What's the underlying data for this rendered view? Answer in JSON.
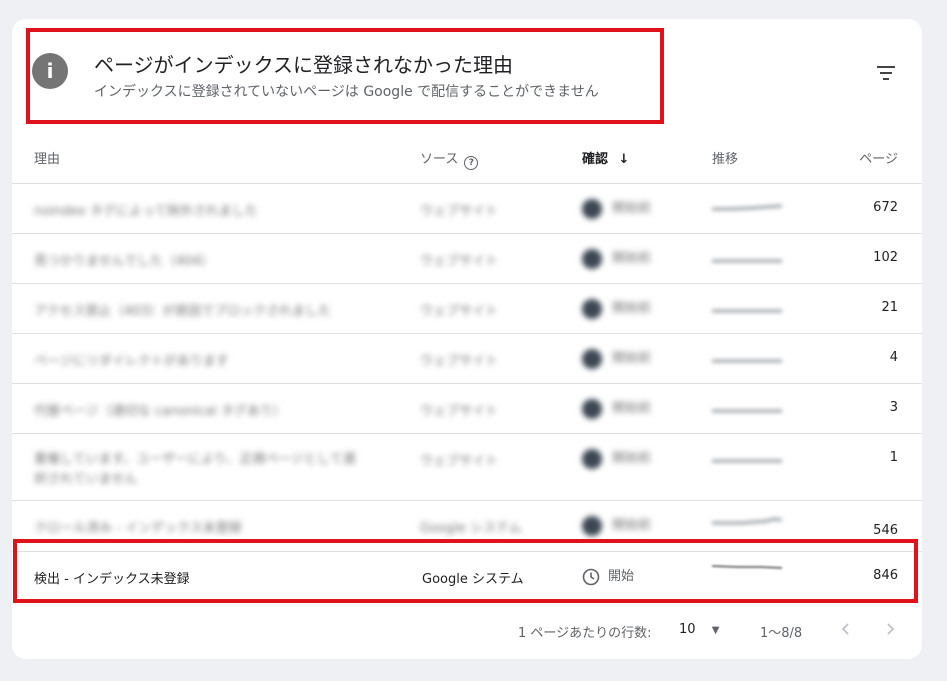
{
  "header": {
    "title": "ページがインデックスに登録されなかった理由",
    "subtitle": "インデックスに登録されていないページは Google で配信することができません",
    "info_icon": "info-icon",
    "filter_icon": "filter-icon"
  },
  "columns": {
    "reason": "理由",
    "source": "ソース",
    "validation": "確認",
    "trend": "推移",
    "pages": "ページ"
  },
  "rows": [
    {
      "reason": "noindex タグによって除外されました",
      "source": "ウェブサイト",
      "status": "開始前",
      "pages": "672"
    },
    {
      "reason": "見つかりませんでした（404）",
      "source": "ウェブサイト",
      "status": "開始前",
      "pages": "102"
    },
    {
      "reason": "アクセス禁止（403）が原因でブロックされました",
      "source": "ウェブサイト",
      "status": "開始前",
      "pages": "21"
    },
    {
      "reason": "ページにリダイレクトがあります",
      "source": "ウェブサイト",
      "status": "開始前",
      "pages": "4"
    },
    {
      "reason": "代替ページ（適切な canonical タグあり）",
      "source": "ウェブサイト",
      "status": "開始前",
      "pages": "3"
    },
    {
      "reason": "重複しています。ユーザーにより、正規ページとして選択されていません",
      "source": "ウェブサイト",
      "status": "開始前",
      "pages": "1"
    },
    {
      "reason": "クロール済み - インデックス未登録",
      "source": "Google システム",
      "status": "開始前",
      "pages": "546"
    }
  ],
  "highlight_row": {
    "reason": "検出 - インデックス未登録",
    "source": "Google システム",
    "status": "開始",
    "pages": "846"
  },
  "pagination": {
    "rows_label": "1 ページあたりの行数:",
    "rows_value": "10",
    "range": "1～8/8"
  }
}
